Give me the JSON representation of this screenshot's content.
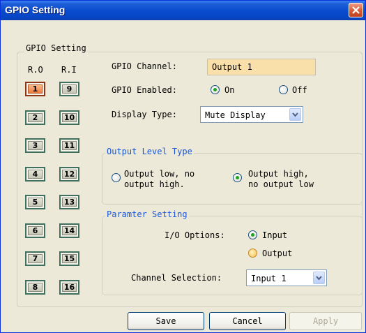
{
  "window": {
    "title": "GPIO Setting"
  },
  "gpio_group": {
    "legend": "GPIO Setting",
    "col_ro": "R.O",
    "col_ri": "R.I",
    "ro_channels": [
      "1",
      "2",
      "3",
      "4",
      "5",
      "6",
      "7",
      "8"
    ],
    "ri_channels": [
      "9",
      "10",
      "11",
      "12",
      "13",
      "14",
      "15",
      "16"
    ],
    "selected_channel": "1"
  },
  "form": {
    "channel_label": "GPIO Channel:",
    "channel_value": "Output 1",
    "enabled_label": "GPIO Enabled:",
    "enabled_on": "On",
    "enabled_off": "Off",
    "enabled_selected": "On",
    "display_label": "Display Type:",
    "display_value": "Mute Display"
  },
  "output_level": {
    "legend": "Output Level Type",
    "option_low": "Output low, no\noutput high.",
    "option_high": "Output high,\nno output low",
    "selected": "high"
  },
  "param": {
    "legend": "Paramter Setting",
    "io_label": "I/O Options:",
    "io_input": "Input",
    "io_output": "Output",
    "io_selected": "Input",
    "channel_sel_label": "Channel Selection:",
    "channel_sel_value": "Input 1"
  },
  "buttons": {
    "save": "Save",
    "cancel": "Cancel",
    "apply": "Apply"
  },
  "colors": {
    "titlebar": "#0a4ccf",
    "accent_text": "#1a55d6",
    "channel_field_bg": "#f9dfaa",
    "active_channel": "#ec7a3d"
  }
}
